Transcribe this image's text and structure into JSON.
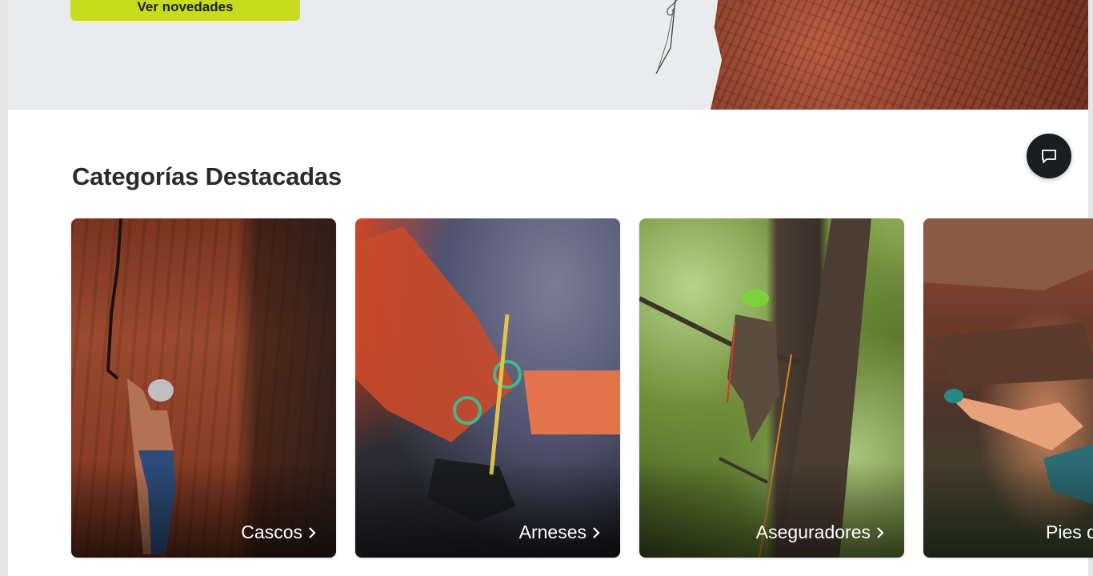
{
  "hero": {
    "cta_label": "Ver novedades"
  },
  "chat": {
    "icon": "chat-bubble-icon"
  },
  "featured": {
    "title": "Categorías Destacadas",
    "categories": [
      {
        "label": "Cascos",
        "icon": "chevron-right-icon"
      },
      {
        "label": "Arneses",
        "icon": "chevron-right-icon"
      },
      {
        "label": "Aseguradores",
        "icon": "chevron-right-icon"
      },
      {
        "label": "Pies de gato",
        "icon": "chevron-right-icon"
      }
    ]
  },
  "colors": {
    "accent": "#c7dc1c",
    "hero_bg": "#e9ebec",
    "fab_bg": "#1b1e20",
    "title_text": "#2b2b2b"
  }
}
